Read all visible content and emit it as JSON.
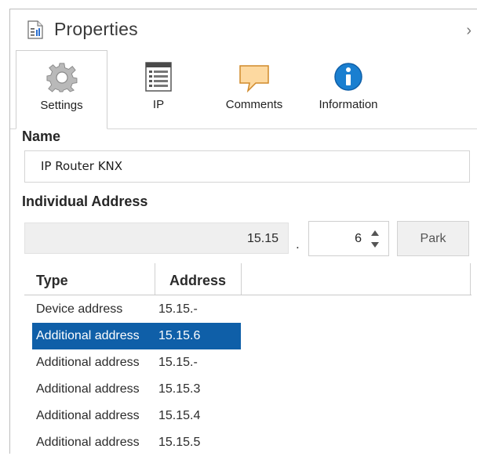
{
  "header": {
    "title": "Properties",
    "collapse_glyph": "›"
  },
  "tabs": [
    {
      "label": "Settings",
      "icon": "gear-icon",
      "active": true
    },
    {
      "label": "IP",
      "icon": "window-list-icon",
      "active": false
    },
    {
      "label": "Comments",
      "icon": "comment-icon",
      "active": false
    },
    {
      "label": "Information",
      "icon": "info-icon",
      "active": false
    }
  ],
  "name_section": {
    "label": "Name",
    "value": "IP Router KNX"
  },
  "address_section": {
    "label": "Individual Address",
    "area": "15.15",
    "separator": ".",
    "device_number": "6",
    "park_label": "Park"
  },
  "table": {
    "columns": [
      "Type",
      "Address"
    ],
    "rows": [
      {
        "type": "Device address",
        "address": "15.15.-",
        "selected": false
      },
      {
        "type": "Additional address",
        "address": "15.15.6",
        "selected": true
      },
      {
        "type": "Additional address",
        "address": "15.15.-",
        "selected": false
      },
      {
        "type": "Additional address",
        "address": "15.15.3",
        "selected": false
      },
      {
        "type": "Additional address",
        "address": "15.15.4",
        "selected": false
      },
      {
        "type": "Additional address",
        "address": "15.15.5",
        "selected": false
      }
    ]
  },
  "colors": {
    "selection": "#0f5fa8",
    "info_blue": "#1a7fd0",
    "comment_orange": "#f0a030"
  }
}
